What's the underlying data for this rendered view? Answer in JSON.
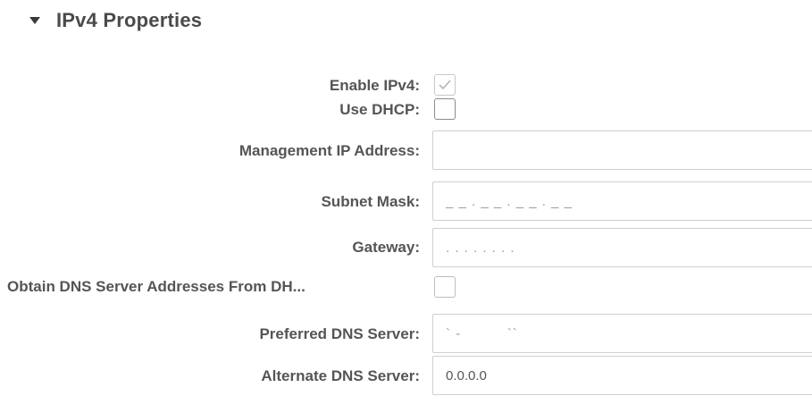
{
  "section": {
    "title": "IPv4 Properties",
    "expanded": true
  },
  "fields": {
    "enable_ipv4": {
      "label": "Enable IPv4:",
      "checked": true,
      "disabled": true
    },
    "use_dhcp": {
      "label": "Use DHCP:",
      "checked": false
    },
    "management_ip": {
      "label": "Management IP Address:",
      "value": ""
    },
    "subnet_mask": {
      "label": "Subnet Mask:",
      "value": "_ _ . _ _ . _ _ . _ _"
    },
    "gateway": {
      "label": "Gateway:",
      "value": ". . . . . . . ."
    },
    "obtain_dns": {
      "label": "Obtain DNS Server Addresses From DH...",
      "checked": false,
      "disabled": true
    },
    "preferred_dns": {
      "label": "Preferred DNS Server:",
      "value": "` -          ``"
    },
    "alternate_dns": {
      "label": "Alternate DNS Server:",
      "value": "0.0.0.0"
    }
  }
}
